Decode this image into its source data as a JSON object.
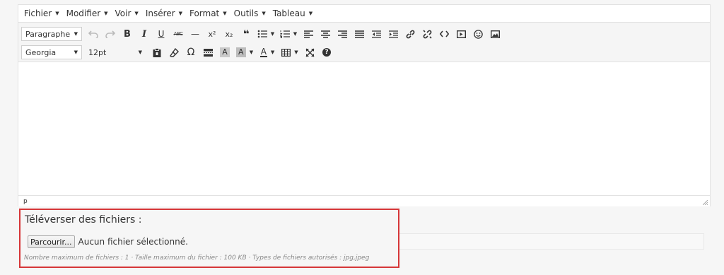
{
  "menubar": {
    "items": [
      {
        "label": "Fichier"
      },
      {
        "label": "Modifier"
      },
      {
        "label": "Voir"
      },
      {
        "label": "Insérer"
      },
      {
        "label": "Format"
      },
      {
        "label": "Outils"
      },
      {
        "label": "Tableau"
      }
    ]
  },
  "toolbar": {
    "block_format": "Paragraphe",
    "font_family": "Georgia",
    "font_size": "12pt",
    "bold": "B",
    "italic": "I",
    "underline": "U",
    "strikethrough": "ABC",
    "hr": "—",
    "superscript": "x²",
    "subscript": "x₂",
    "blockquote": "❝",
    "special_char": "Ω",
    "bg_color": "A",
    "text_color_a": "A",
    "font_color": "A",
    "help": "?"
  },
  "statusbar": {
    "path": "p"
  },
  "upload": {
    "title": "Téléverser des fichiers :",
    "browse_label": "Parcourir...",
    "no_file": "Aucun fichier sélectionné.",
    "hint": "Nombre maximum de fichiers : 1 · Taille maximum du fichier : 100 KB · Types de fichiers autorisés : jpg,jpeg"
  },
  "colors": {
    "highlight_border": "#d63638",
    "editor_border": "#e2e2e2",
    "toolbar_bg": "#f5f5f5"
  }
}
